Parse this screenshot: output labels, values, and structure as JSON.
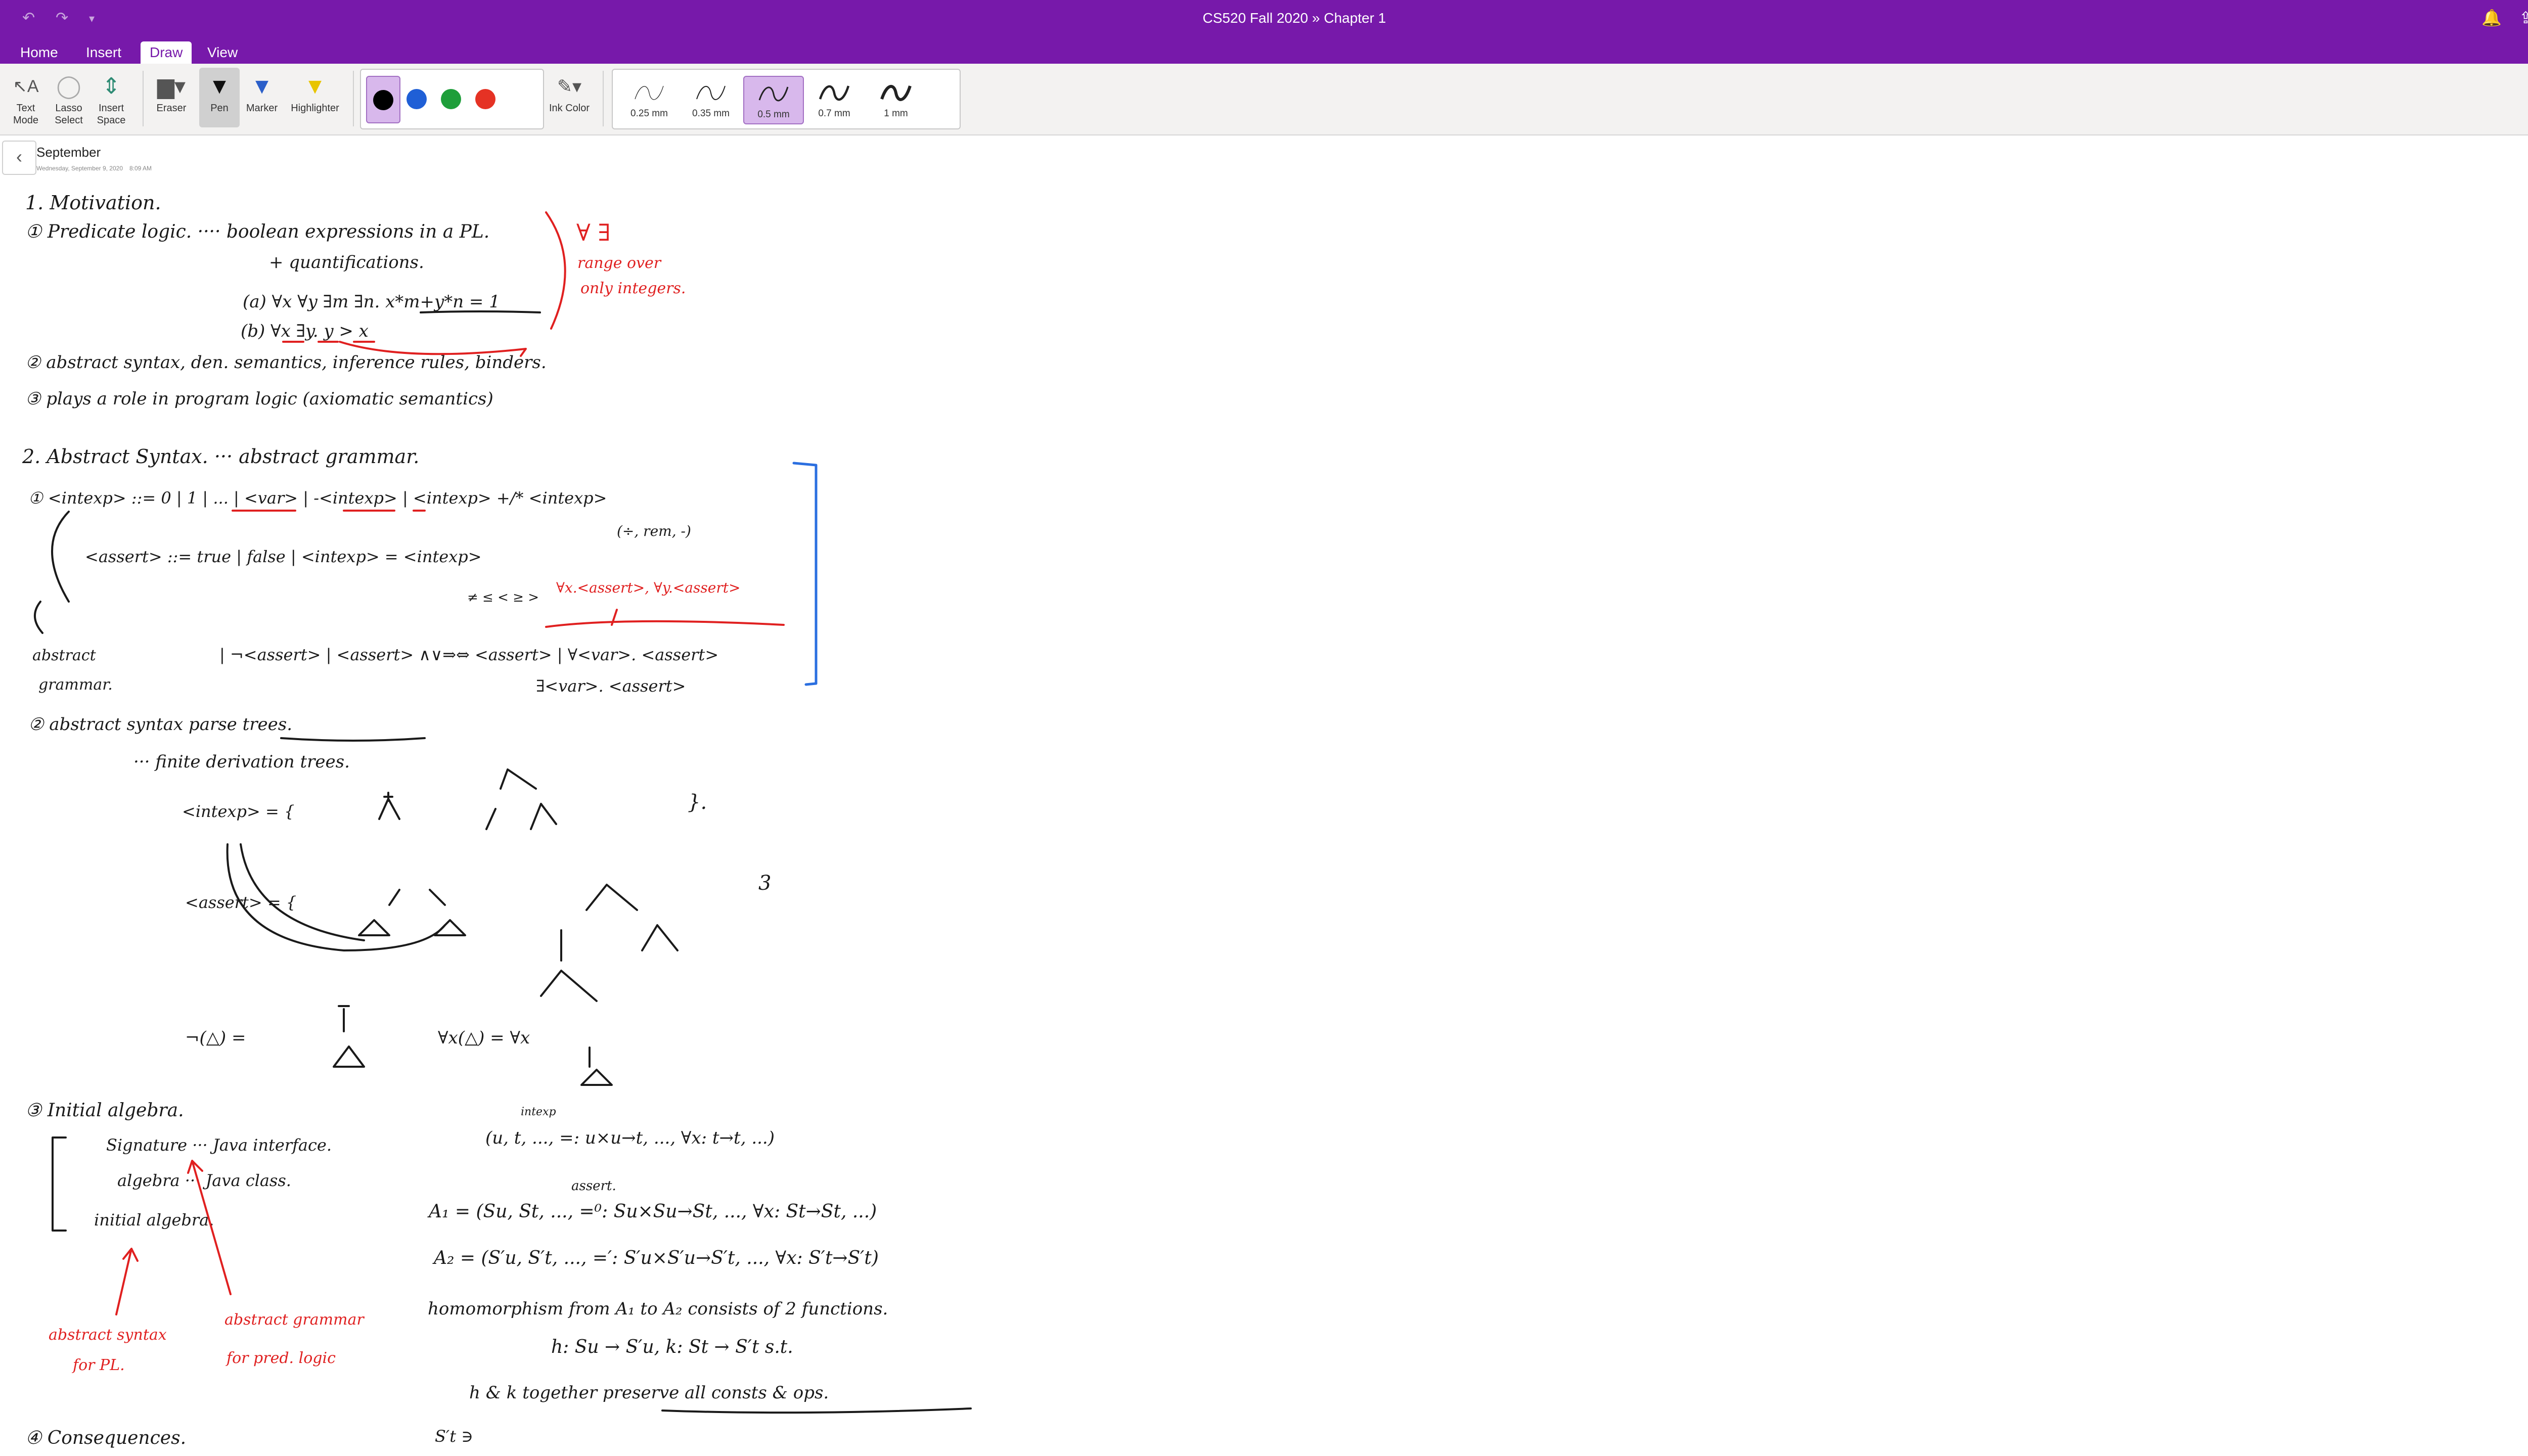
{
  "window": {
    "title_notebook": "CS520 Fall 2020",
    "title_separator": "»",
    "title_section": "Chapter 1"
  },
  "tabs": [
    {
      "label": "Home"
    },
    {
      "label": "Insert"
    },
    {
      "label": "Draw",
      "active": true
    },
    {
      "label": "View"
    }
  ],
  "ribbon": {
    "tools": {
      "text_mode": "Text Mode",
      "lasso_select": "Lasso Select",
      "insert_space": "Insert Space",
      "eraser": "Eraser",
      "pen": "Pen",
      "marker": "Marker",
      "highlighter": "Highlighter",
      "ink_color": "Ink Color"
    },
    "colors": [
      "#000000",
      "#1f5fd6",
      "#1e9e3a",
      "#e53224"
    ],
    "selected_color": "#000000",
    "strokes": [
      "0.25 mm",
      "0.35 mm",
      "0.5 mm",
      "0.7 mm",
      "1 mm"
    ],
    "selected_stroke": "0.5 mm"
  },
  "page": {
    "title": "September",
    "date": "Wednesday, September 9, 2020",
    "time": "8:09 AM"
  },
  "accent_color": "#7719aa",
  "ink": {
    "s1": "1. Motivation.",
    "s1_1": "① Predicate logic. ····  boolean expressions in a PL.",
    "s1_1b": "+ quantifications.",
    "s1_1a": "(a) ∀x ∀y ∃m ∃n.  x*m+y*n = 1",
    "s1_1bex": "(b) ∀x ∃y.  y > x",
    "r_quant": "∀ ∃",
    "r_range1": "range over",
    "r_range2": "only integers.",
    "s1_2": "② abstract syntax, den. semantics, inference rules, binders.",
    "s1_3": "③ plays a role in program logic (axiomatic semantics)",
    "s2": "2. Abstract Syntax. ···  abstract grammar.",
    "g1": "① <intexp> ::= 0 | 1 | ... | <var> | -<intexp> | <intexp> +/* <intexp>",
    "g1b": "(÷, rem, -)",
    "g2": "<assert> ::= true | false | <intexp> = <intexp>",
    "g2ops": "≠ ≤ < ≥ >",
    "g3": "| ¬<assert> | <assert> ∧∨⇒⇔ <assert> | ∀<var>. <assert>",
    "g4": "∃<var>. <assert>",
    "r_forall": "∀x.<assert>, ∀y.<assert>",
    "abs_g1": "abstract",
    "abs_g2": "grammar.",
    "s2_2": "② abstract syntax    parse trees.",
    "s2_2b": "··· finite derivation trees.",
    "tree_int": "<intexp> = {",
    "tree_assert": "<assert> = {",
    "tree_neg": "¬(△) =",
    "tree_all": "∀x(△) = ∀x",
    "s3": "③ Initial algebra.",
    "sig": "Signature ··· Java interface.",
    "alg": "algebra ··· Java class.",
    "ialg": "initial algebra.",
    "r_abs1": "abstract syntax",
    "r_abs2": "for PL.",
    "r_absg1": "abstract grammar",
    "r_absg2": "for pred. logic",
    "sig_ex": "(u, t, ..., =: u×u→t, ..., ∀x: t→t, ...)",
    "sig_intexp": "intexp",
    "sig_assert": "assert.",
    "A1": "A₁ = (Su, St, ..., =⁰: Su×Su→St, ..., ∀x: St→St, ...)",
    "A2": "A₂ = (S′u, S′t, ..., =′: S′u×S′u→S′t, ..., ∀x: S′t→S′t)",
    "homo": "homomorphism from A₁ to A₂ consists of 2 functions.",
    "hk": "h: Su → S′u,   k: St → S′t   s.t.",
    "pres": "h & k together  preserve all consts & ops.",
    "s4": "④ Consequences.",
    "st": "S′t ∋"
  }
}
